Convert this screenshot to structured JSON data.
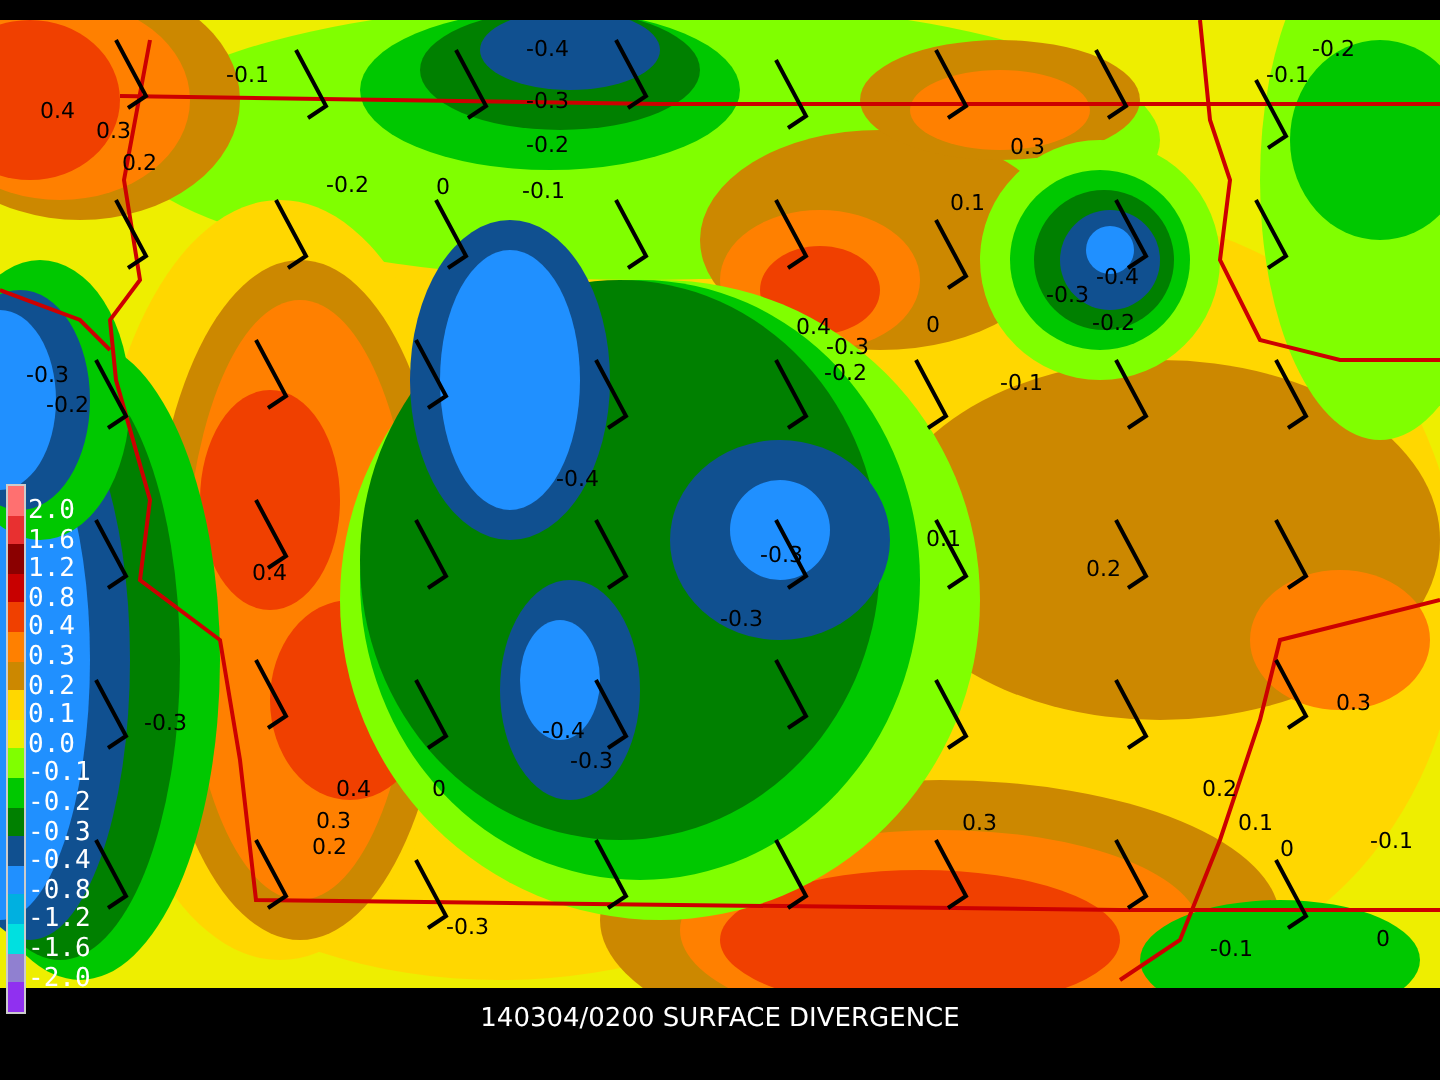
{
  "map": {
    "contour_labels": [
      "-0.4",
      "-0.2",
      "-0.1",
      "-0.1",
      "-0.3",
      "0.4",
      "0.3",
      "-0.2",
      "0.3",
      "0.2",
      "-0.2",
      "0",
      "-0.1",
      "0.1",
      "-0.4",
      "-0.3",
      "0.4",
      "0",
      "-0.2",
      "-0.3",
      "-0.3",
      "-0.2",
      "-0.1",
      "-0.2",
      "-0.4",
      "0.1",
      "0.4",
      "-0.3",
      "0.2",
      "-0.3",
      "0.3",
      "-0.3",
      "-0.4",
      "-0.3",
      "0.4",
      "0",
      "0.2",
      "0.3",
      "0.3",
      "0.1",
      "0.2",
      "0",
      "-0.1",
      "-0.3",
      "-0.1",
      "0"
    ]
  },
  "legend": {
    "swatches": [
      {
        "color": "#ff7070"
      },
      {
        "color": "#e83030"
      },
      {
        "color": "#8b0000"
      },
      {
        "color": "#c80000"
      },
      {
        "color": "#f04000"
      },
      {
        "color": "#ff8000"
      },
      {
        "color": "#cc8800"
      },
      {
        "color": "#ffd700"
      },
      {
        "color": "#eeee00"
      },
      {
        "color": "#80ff00"
      },
      {
        "color": "#00c800"
      },
      {
        "color": "#008000"
      },
      {
        "color": "#105090"
      },
      {
        "color": "#2090ff"
      },
      {
        "color": "#00b0e0"
      },
      {
        "color": "#00e0e0"
      },
      {
        "color": "#9080d0"
      },
      {
        "color": "#9030f0"
      }
    ],
    "labels": [
      "2.0",
      "1.6",
      "1.2",
      "0.8",
      "0.4",
      "0.3",
      "0.2",
      "0.1",
      "0.0",
      "-0.1",
      "-0.2",
      "-0.3",
      "-0.4",
      "-0.8",
      "-1.2",
      "-1.6",
      "-2.0"
    ]
  },
  "caption": "140304/0200 SURFACE DIVERGENCE"
}
